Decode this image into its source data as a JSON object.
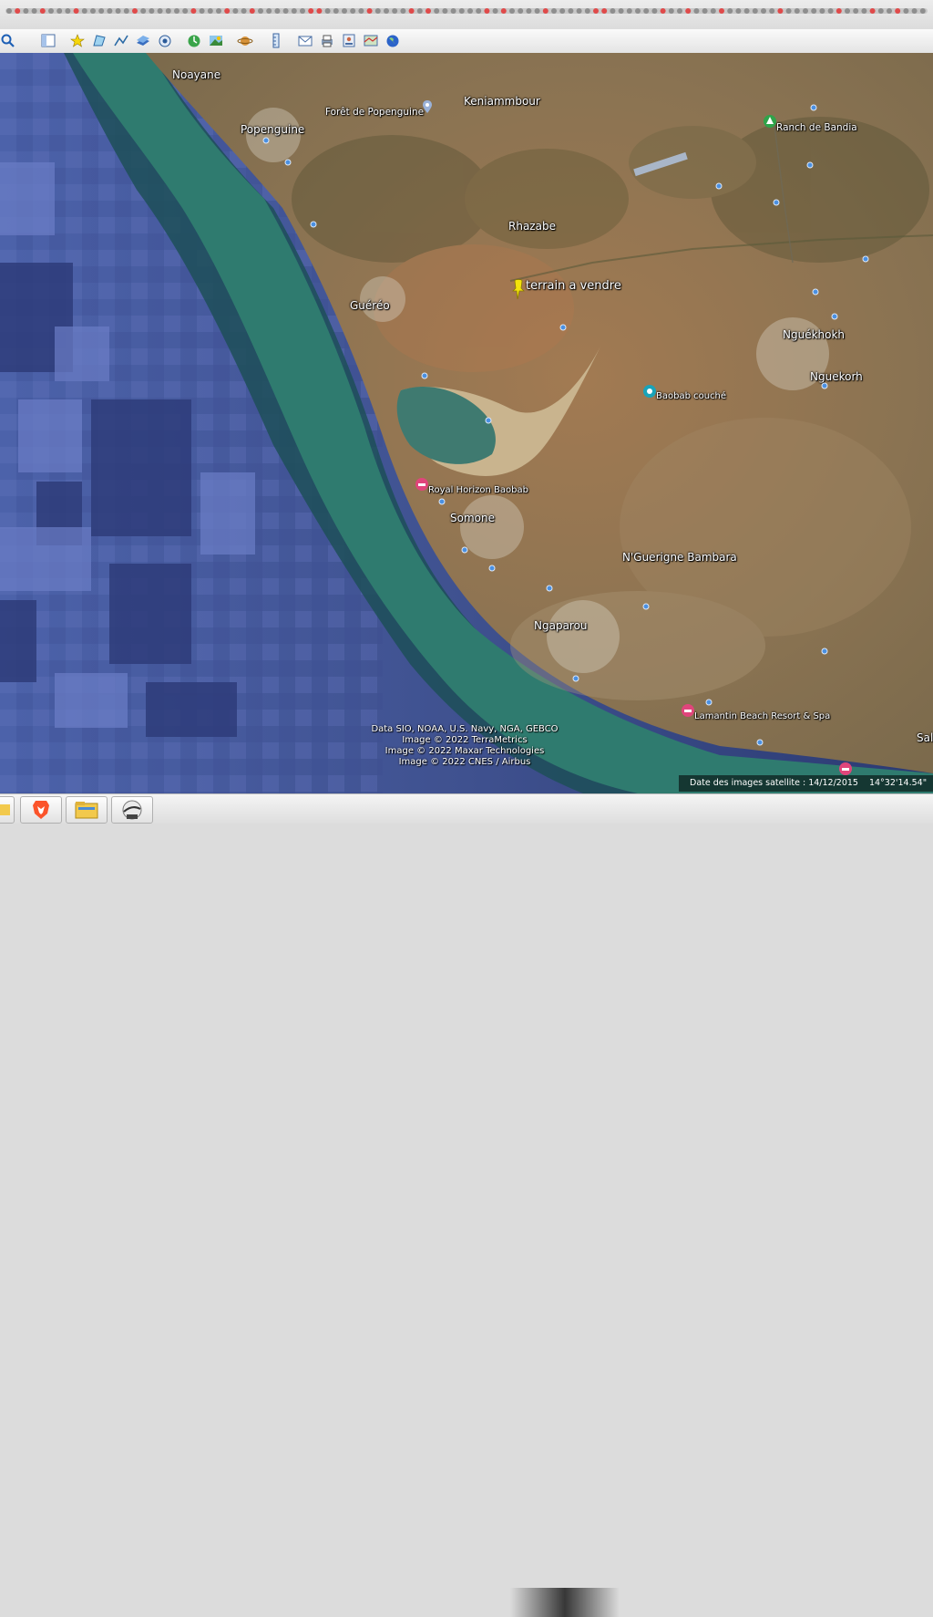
{
  "map": {
    "pin_label": "terrain a vendre",
    "places": {
      "noayane": "Noayane",
      "popenguine": "Popenguine",
      "foret": "Forêt de Popenguine",
      "keniambour": "Keniammbour",
      "ranch": "Ranch de Bandia",
      "rhazabe": "Rhazabe",
      "guereo": "Guéréo",
      "nguekhokh": "Nguékhokh",
      "nguekorh": "Nguekorh",
      "baobab": "Baobab couché",
      "royal": "Royal Horizon Baobab",
      "somone": "Somone",
      "nguerigne": "N'Guerigne Bambara",
      "ngaparou": "Ngaparou",
      "lamantin": "Lamantin Beach Resort & Spa",
      "sal": "Sal"
    }
  },
  "credits": {
    "line1": "Data SIO, NOAA, U.S. Navy, NGA, GEBCO",
    "line2": "Image © 2022 TerraMetrics",
    "line3": "Image © 2022 Maxar Technologies",
    "line4": "Image © 2022 CNES / Airbus"
  },
  "status": {
    "imagery_date": "Date des images satellite : 14/12/2015",
    "coords": "14°32'14.54\""
  },
  "colors": {
    "ocean_deep": "#3a4a8e",
    "ocean_mid": "#5d6fb6",
    "shallow_water": "#2f7b6f",
    "land": "#8b7350",
    "pin": "#f2e20c",
    "poi_blue": "#4a90e2",
    "poi_pink": "#e0457b",
    "poi_green": "#2fa34a"
  },
  "toolbar": {
    "icons": [
      "search-icon",
      "sidebar-icon",
      "add-placemark-icon",
      "add-polygon-icon",
      "add-path-icon",
      "add-overlay-icon",
      "record-tour-icon",
      "historical-imagery-icon",
      "sunlight-icon",
      "planets-icon",
      "ruler-icon",
      "email-icon",
      "print-icon",
      "save-image-icon",
      "maps-icon",
      "earth-icon"
    ]
  },
  "taskbar": {
    "apps": [
      "folder-icon",
      "brave-browser-icon",
      "file-explorer-icon",
      "google-earth-icon"
    ]
  }
}
